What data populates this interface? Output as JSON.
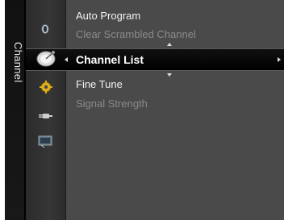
{
  "side_tab": {
    "label": "Channel"
  },
  "icons": [
    "picture-icon",
    "channel-dish-icon",
    "setup-gear-icon",
    "input-plug-icon",
    "application-icon"
  ],
  "menu": {
    "items": [
      {
        "label": "Auto Program",
        "state": "normal"
      },
      {
        "label": "Clear Scrambled Channel",
        "state": "dim"
      },
      {
        "label": "Channel List",
        "state": "selected"
      },
      {
        "label": "Fine Tune",
        "state": "normal"
      },
      {
        "label": "Signal Strength",
        "state": "dim"
      }
    ]
  },
  "colors": {
    "panel": "#4a4a4a",
    "icon_column": "#333333",
    "highlight": "#000000",
    "text": "#f2f2f2",
    "text_dim": "#8a8a8a"
  }
}
